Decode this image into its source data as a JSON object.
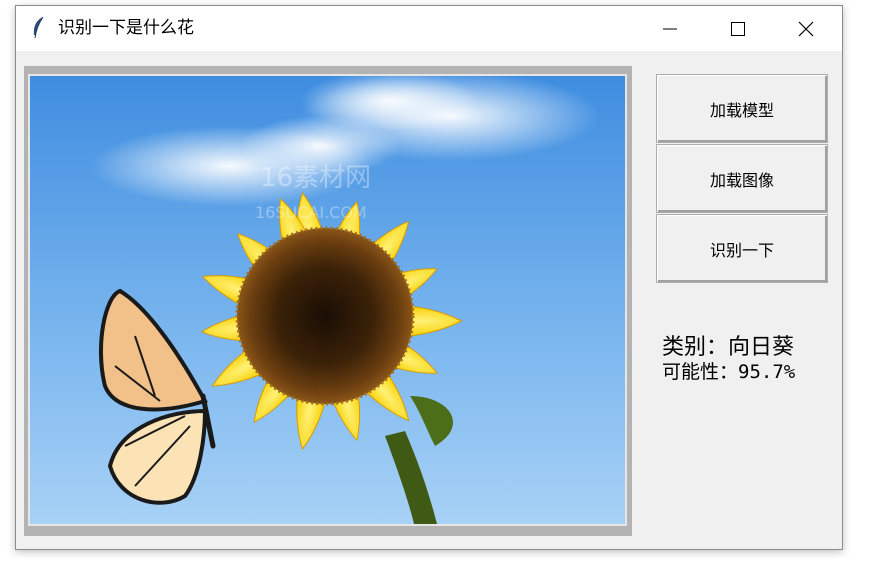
{
  "window": {
    "title": "识别一下是什么花",
    "icon": "feather-icon",
    "controls": [
      "minimize-icon",
      "maximize-icon",
      "close-icon"
    ]
  },
  "image_panel": {
    "subject": "sunflower-with-butterfly-photo",
    "watermark": "16素材网 16SUCAI.COM"
  },
  "buttons": {
    "load_model": "加载模型",
    "load_image": "加载图像",
    "identify": "识别一下"
  },
  "result": {
    "category_line": "类别：向日葵",
    "probability_line": "可能性：95.7%"
  }
}
